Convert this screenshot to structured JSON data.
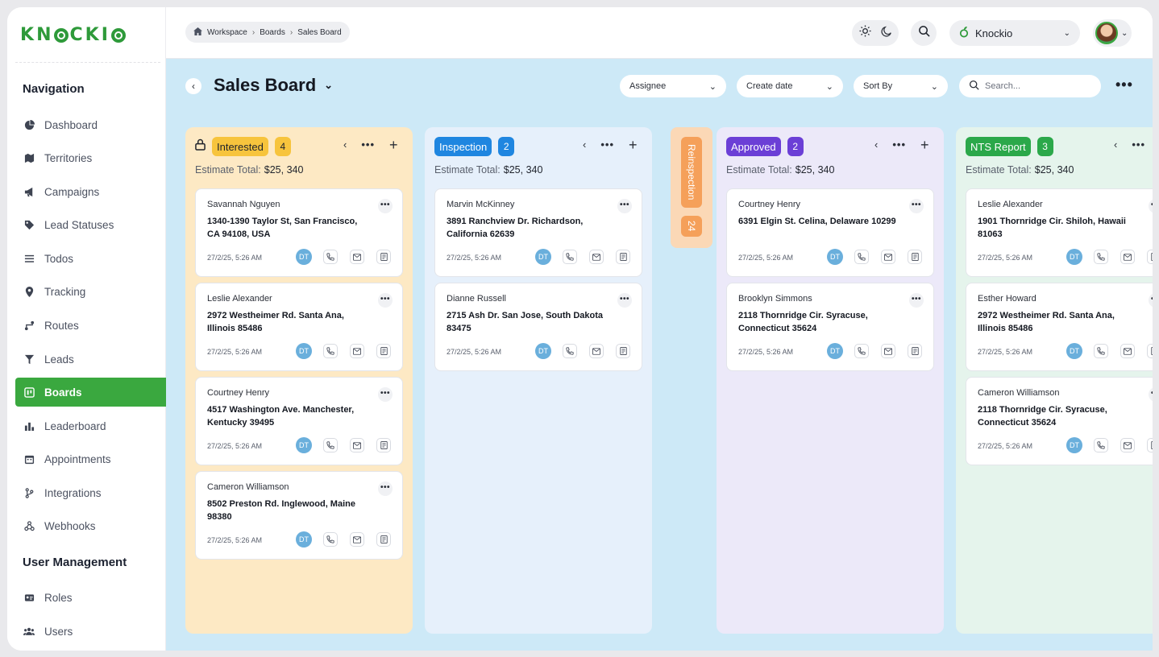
{
  "app": {
    "brand": "KNOCKIO"
  },
  "sidebar": {
    "nav_heading": "Navigation",
    "items": [
      {
        "label": "Dashboard",
        "icon": "pie-chart-icon"
      },
      {
        "label": "Territories",
        "icon": "map-icon"
      },
      {
        "label": "Campaigns",
        "icon": "megaphone-icon"
      },
      {
        "label": "Lead Statuses",
        "icon": "tag-icon"
      },
      {
        "label": "Todos",
        "icon": "list-icon"
      },
      {
        "label": "Tracking",
        "icon": "location-pin-icon"
      },
      {
        "label": "Routes",
        "icon": "route-icon"
      },
      {
        "label": "Leads",
        "icon": "funnel-icon"
      },
      {
        "label": "Boards",
        "icon": "board-icon",
        "active": true
      },
      {
        "label": "Leaderboard",
        "icon": "bar-chart-icon"
      },
      {
        "label": "Appointments",
        "icon": "calendar-icon"
      },
      {
        "label": "Integrations",
        "icon": "git-branch-icon"
      },
      {
        "label": "Webhooks",
        "icon": "webhook-icon"
      }
    ],
    "user_heading": "User Management",
    "user_items": [
      {
        "label": "Roles",
        "icon": "id-card-icon"
      },
      {
        "label": "Users",
        "icon": "users-icon"
      }
    ]
  },
  "topbar": {
    "breadcrumb": [
      "Workspace",
      "Boards",
      "Sales Board"
    ],
    "org_name": "Knockio"
  },
  "board": {
    "title": "Sales Board",
    "filters": {
      "assignee": "Assignee",
      "create_date": "Create date",
      "sort_by": "Sort By",
      "search_placeholder": "Search..."
    },
    "estimate_label": "Estimate Total:",
    "columns": [
      {
        "name": "Interested",
        "count": "4",
        "estimate": "$25, 340",
        "color": "#f7c43d",
        "bg": "#fde9c4",
        "cards": [
          {
            "name": "Savannah Nguyen",
            "address": "1340-1390 Taylor St, San Francisco, CA 94108, USA",
            "date": "27/2/25, 5:26 AM",
            "initials": "DT"
          },
          {
            "name": "Leslie Alexander",
            "address": "2972 Westheimer Rd. Santa Ana, Illinois 85486",
            "date": "27/2/25, 5:26 AM",
            "initials": "DT"
          },
          {
            "name": "Courtney Henry",
            "address": "4517 Washington Ave. Manchester, Kentucky 39495",
            "date": "27/2/25, 5:26 AM",
            "initials": "DT"
          },
          {
            "name": "Cameron Williamson",
            "address": "8502 Preston Rd. Inglewood, Maine 98380",
            "date": "27/2/25, 5:26 AM",
            "initials": "DT"
          }
        ]
      },
      {
        "name": "Inspection",
        "count": "2",
        "estimate": "$25, 340",
        "color": "#1f86e0",
        "bg": "#e6f0fb",
        "cards": [
          {
            "name": "Marvin McKinney",
            "address": "3891 Ranchview Dr. Richardson, California 62639",
            "date": "27/2/25, 5:26 AM",
            "initials": "DT"
          },
          {
            "name": "Dianne Russell",
            "address": "2715 Ash Dr. San Jose, South Dakota 83475",
            "date": "27/2/25, 5:26 AM",
            "initials": "DT"
          }
        ]
      },
      {
        "name": "Approved",
        "count": "2",
        "estimate": "$25, 340",
        "color": "#6b3fd6",
        "bg": "#ece9f9",
        "cards": [
          {
            "name": "Courtney Henry",
            "address": "6391 Elgin St. Celina, Delaware 10299",
            "date": "27/2/25, 5:26 AM",
            "initials": "DT"
          },
          {
            "name": "Brooklyn Simmons",
            "address": "2118 Thornridge Cir. Syracuse, Connecticut 35624",
            "date": "27/2/25, 5:26 AM",
            "initials": "DT"
          }
        ]
      },
      {
        "name": "NTS Report",
        "count": "3",
        "estimate": "$25, 340",
        "color": "#2ba84a",
        "bg": "#e5f4ec",
        "cards": [
          {
            "name": "Leslie Alexander",
            "address": "1901 Thornridge Cir. Shiloh, Hawaii 81063",
            "date": "27/2/25, 5:26 AM",
            "initials": "DT"
          },
          {
            "name": "Esther Howard",
            "address": "2972 Westheimer Rd. Santa Ana, Illinois 85486",
            "date": "27/2/25, 5:26 AM",
            "initials": "DT"
          },
          {
            "name": "Cameron Williamson",
            "address": "2118 Thornridge Cir. Syracuse, Connecticut 35624",
            "date": "27/2/25, 5:26 AM",
            "initials": "DT"
          }
        ]
      }
    ],
    "collapsed_column": {
      "name": "Reinspection",
      "count": "24"
    }
  }
}
